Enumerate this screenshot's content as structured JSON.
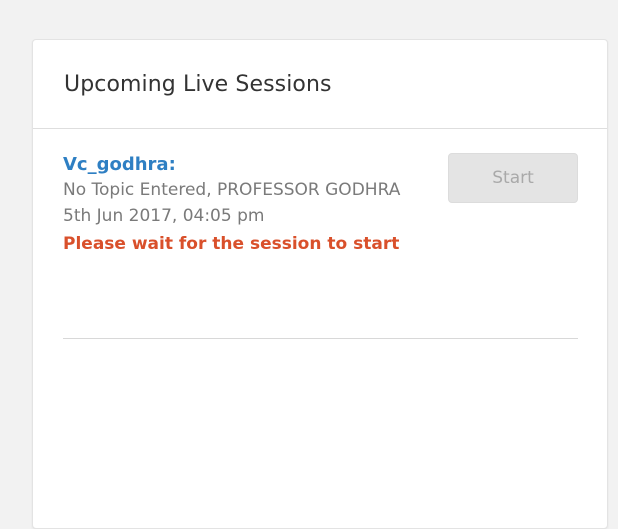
{
  "panel": {
    "title": "Upcoming Live Sessions"
  },
  "sessions": [
    {
      "name": "Vc_godhra:",
      "topic": "No Topic Entered, PROFESSOR GODHRA",
      "datetime": "5th Jun 2017, 04:05 pm",
      "status": "Please wait for the session to start",
      "action_label": "Start",
      "action_enabled": false
    }
  ],
  "colors": {
    "background": "#f2f2f2",
    "card": "#ffffff",
    "session_name": "#2e7fc3",
    "muted_text": "#7a7a7a",
    "status_warning": "#d9502b",
    "button_disabled_bg": "#e4e4e4",
    "button_disabled_text": "#a9a9a9"
  }
}
